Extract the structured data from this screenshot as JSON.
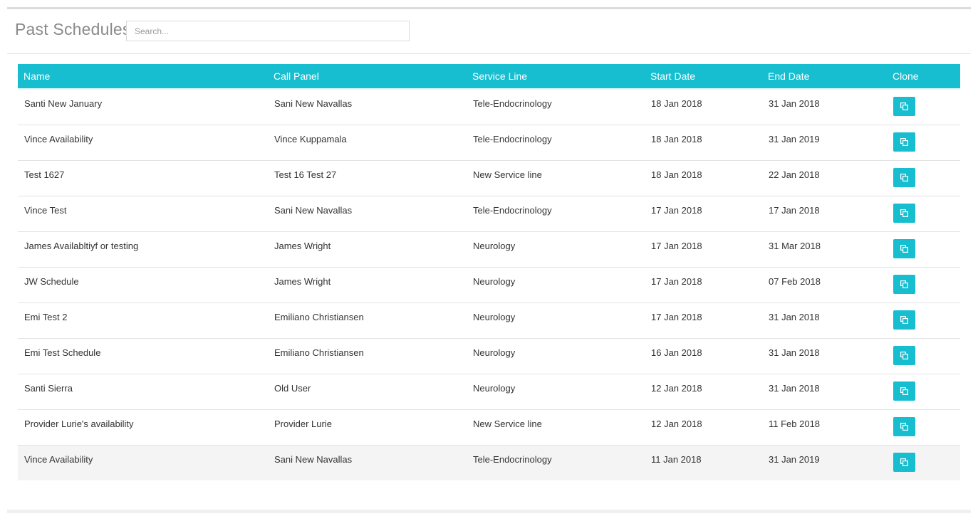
{
  "header": {
    "title": "Past Schedules",
    "search_placeholder": "Search..."
  },
  "table": {
    "columns": [
      "Name",
      "Call Panel",
      "Service Line",
      "Start Date",
      "End Date",
      "Clone"
    ],
    "rows": [
      {
        "name": "Santi New January",
        "call_panel": "Sani New Navallas",
        "service_line": "Tele-Endocrinology",
        "start_date": "18 Jan 2018",
        "end_date": "31 Jan 2018"
      },
      {
        "name": "Vince Availability",
        "call_panel": "Vince Kuppamala",
        "service_line": "Tele-Endocrinology",
        "start_date": "18 Jan 2018",
        "end_date": "31 Jan 2019"
      },
      {
        "name": "Test 1627",
        "call_panel": "Test 16 Test 27",
        "service_line": "New Service line",
        "start_date": "18 Jan 2018",
        "end_date": "22 Jan 2018"
      },
      {
        "name": "Vince Test",
        "call_panel": "Sani New Navallas",
        "service_line": "Tele-Endocrinology",
        "start_date": "17 Jan 2018",
        "end_date": "17 Jan 2018"
      },
      {
        "name": "James Availabltiyf or testing",
        "call_panel": "James Wright",
        "service_line": "Neurology",
        "start_date": "17 Jan 2018",
        "end_date": "31 Mar 2018"
      },
      {
        "name": "JW Schedule",
        "call_panel": "James Wright",
        "service_line": "Neurology",
        "start_date": "17 Jan 2018",
        "end_date": "07 Feb 2018"
      },
      {
        "name": "Emi Test 2",
        "call_panel": "Emiliano Christiansen",
        "service_line": "Neurology",
        "start_date": "17 Jan 2018",
        "end_date": "31 Jan 2018"
      },
      {
        "name": "Emi Test Schedule",
        "call_panel": "Emiliano Christiansen",
        "service_line": "Neurology",
        "start_date": "16 Jan 2018",
        "end_date": "31 Jan 2018"
      },
      {
        "name": "Santi Sierra",
        "call_panel": "Old User",
        "service_line": "Neurology",
        "start_date": "12 Jan 2018",
        "end_date": "31 Jan 2018"
      },
      {
        "name": "Provider Lurie's availability",
        "call_panel": "Provider Lurie",
        "service_line": "New Service line",
        "start_date": "12 Jan 2018",
        "end_date": "11 Feb 2018"
      },
      {
        "name": "Vince Availability",
        "call_panel": "Sani New Navallas",
        "service_line": "Tele-Endocrinology",
        "start_date": "11 Jan 2018",
        "end_date": "31 Jan 2019"
      }
    ]
  },
  "icons": {
    "clone": "copy-icon"
  },
  "colors": {
    "accent": "#17bed0",
    "title": "#8a8a8a",
    "highlight_row": "#f4f4f4"
  }
}
